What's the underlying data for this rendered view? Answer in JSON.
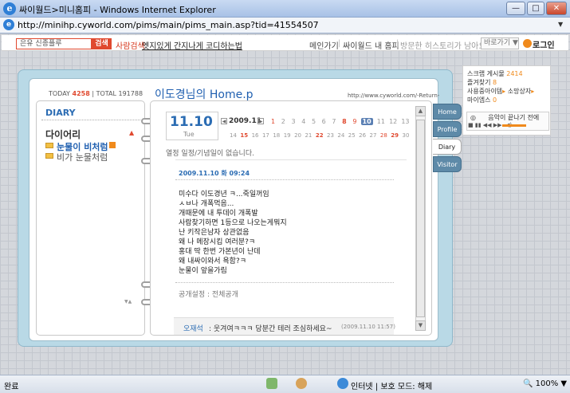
{
  "window": {
    "title": "싸이월드>미니홈피 - Windows Internet Explorer",
    "url": "http://minihp.cyworld.com/pims/main/pims_main.asp?tid=41554507"
  },
  "topnav": {
    "search_placeholder": "은유 신종플루",
    "search_button": "검색",
    "people_search": "사람검색",
    "promo_link": "엣지있게 간지나게 코디하는법",
    "links": [
      "메인가기",
      "싸이월드 내 홈피",
      "방문한 히스토리가 남아요"
    ],
    "shortcut": "바로가기 ▼",
    "login": "로그인"
  },
  "header": {
    "today_label": "TODAY",
    "today_count": "4258",
    "total_label": "TOTAL",
    "total_count": "191788",
    "title": "이도경님의 Home.p",
    "url": "http://www.cyworld.com/-Return-"
  },
  "left": {
    "heading": "DIARY",
    "category": "다이어리",
    "folders": [
      "눈물이 비처럼",
      "비가 눈물처럼"
    ]
  },
  "calendar": {
    "big_date": "11.10",
    "day_name": "Tue",
    "month": "2009.11",
    "days_row1": [
      "1",
      "2",
      "3",
      "4",
      "5",
      "6",
      "7",
      "8",
      "9",
      "10",
      "11",
      "12",
      "13"
    ],
    "days_row2": [
      "14",
      "15",
      "16",
      "17",
      "18",
      "19",
      "20",
      "21",
      "22",
      "23",
      "24",
      "25",
      "26",
      "27",
      "28",
      "29",
      "30"
    ],
    "selected_day": "10"
  },
  "post": {
    "no_schedule": "열정 일정/기념일이 없습니다.",
    "date": "2009.11.10 화 09:24",
    "lines": [
      "미수다 이도경년 ㅋ...죽일꺼임",
      "ㅅㅂ나 개폭먹음...",
      "개때문에 내 투데이 개폭발",
      "사람찾기하면 1등으로 나오는게뭐지",
      "난 키작은남자 상관없음",
      "왜 나 메장시킴 여러분?ㅋ",
      "홍대 딱 한번 가본년이 난데",
      "왜 내싸이와서 욕함?ㅋ",
      "눈물이 앞을가림"
    ],
    "visibility": "공개설정 : 전체공개",
    "comment_author": "오재석",
    "comment_text": ": 웃겨여ㅋㅋㅋ 당분간 테러 조심하세요~",
    "comment_time": "(2009.11.10 11:57)"
  },
  "tabs": [
    "Home",
    "Profile",
    "Diary",
    "Visitor"
  ],
  "widget": {
    "scrap_label": "스크랩 게시물",
    "scrap_count": "2414",
    "fav_label": "즐겨찾기",
    "fav_count": "8",
    "item_label": "사용중아이템",
    "gift_label": "소망상자",
    "mileage_label": "마이엠스",
    "mileage_count": "0",
    "music": "음악이 끝나기 전에"
  },
  "status": {
    "left": "완료",
    "zone": "인터넷 | 보호 모드: 해제",
    "zoom": "100%"
  }
}
